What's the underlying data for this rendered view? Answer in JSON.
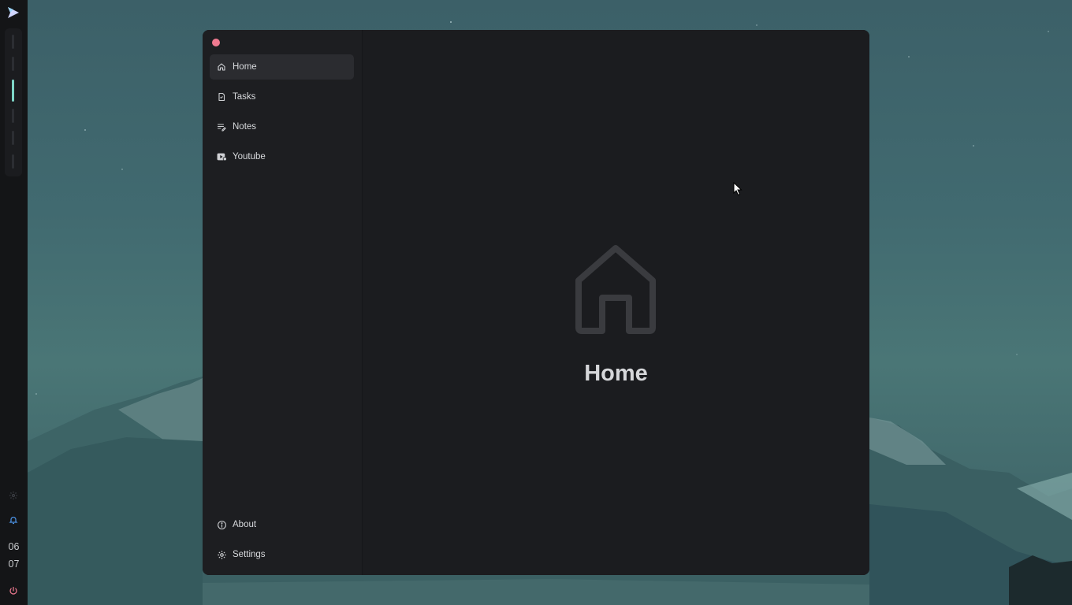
{
  "wallpaper": {
    "icon": "mountain-landscape"
  },
  "bar": {
    "logo_icon": "app-launcher-logo-icon",
    "workspace_count": 6,
    "active_workspace": 3,
    "settings_icon": "gear-icon",
    "notification_icon": "bell-icon",
    "clock": {
      "hours": "06",
      "minutes": "07"
    },
    "power_icon": "power-icon",
    "colors": {
      "accent": "#7ed6c8",
      "notification": "#4a8fe0",
      "power": "#f07a90"
    }
  },
  "window": {
    "close_color": "#f07a90",
    "sidebar": {
      "items": [
        {
          "label": "Home",
          "icon": "home-icon",
          "selected": true
        },
        {
          "label": "Tasks",
          "icon": "task-check-icon",
          "selected": false
        },
        {
          "label": "Notes",
          "icon": "notes-edit-icon",
          "selected": false
        },
        {
          "label": "Youtube",
          "icon": "video-icon",
          "selected": false
        }
      ],
      "footer_items": [
        {
          "label": "About",
          "icon": "info-icon"
        },
        {
          "label": "Settings",
          "icon": "gear-icon"
        }
      ]
    },
    "main": {
      "icon": "home-icon",
      "title": "Home"
    }
  }
}
